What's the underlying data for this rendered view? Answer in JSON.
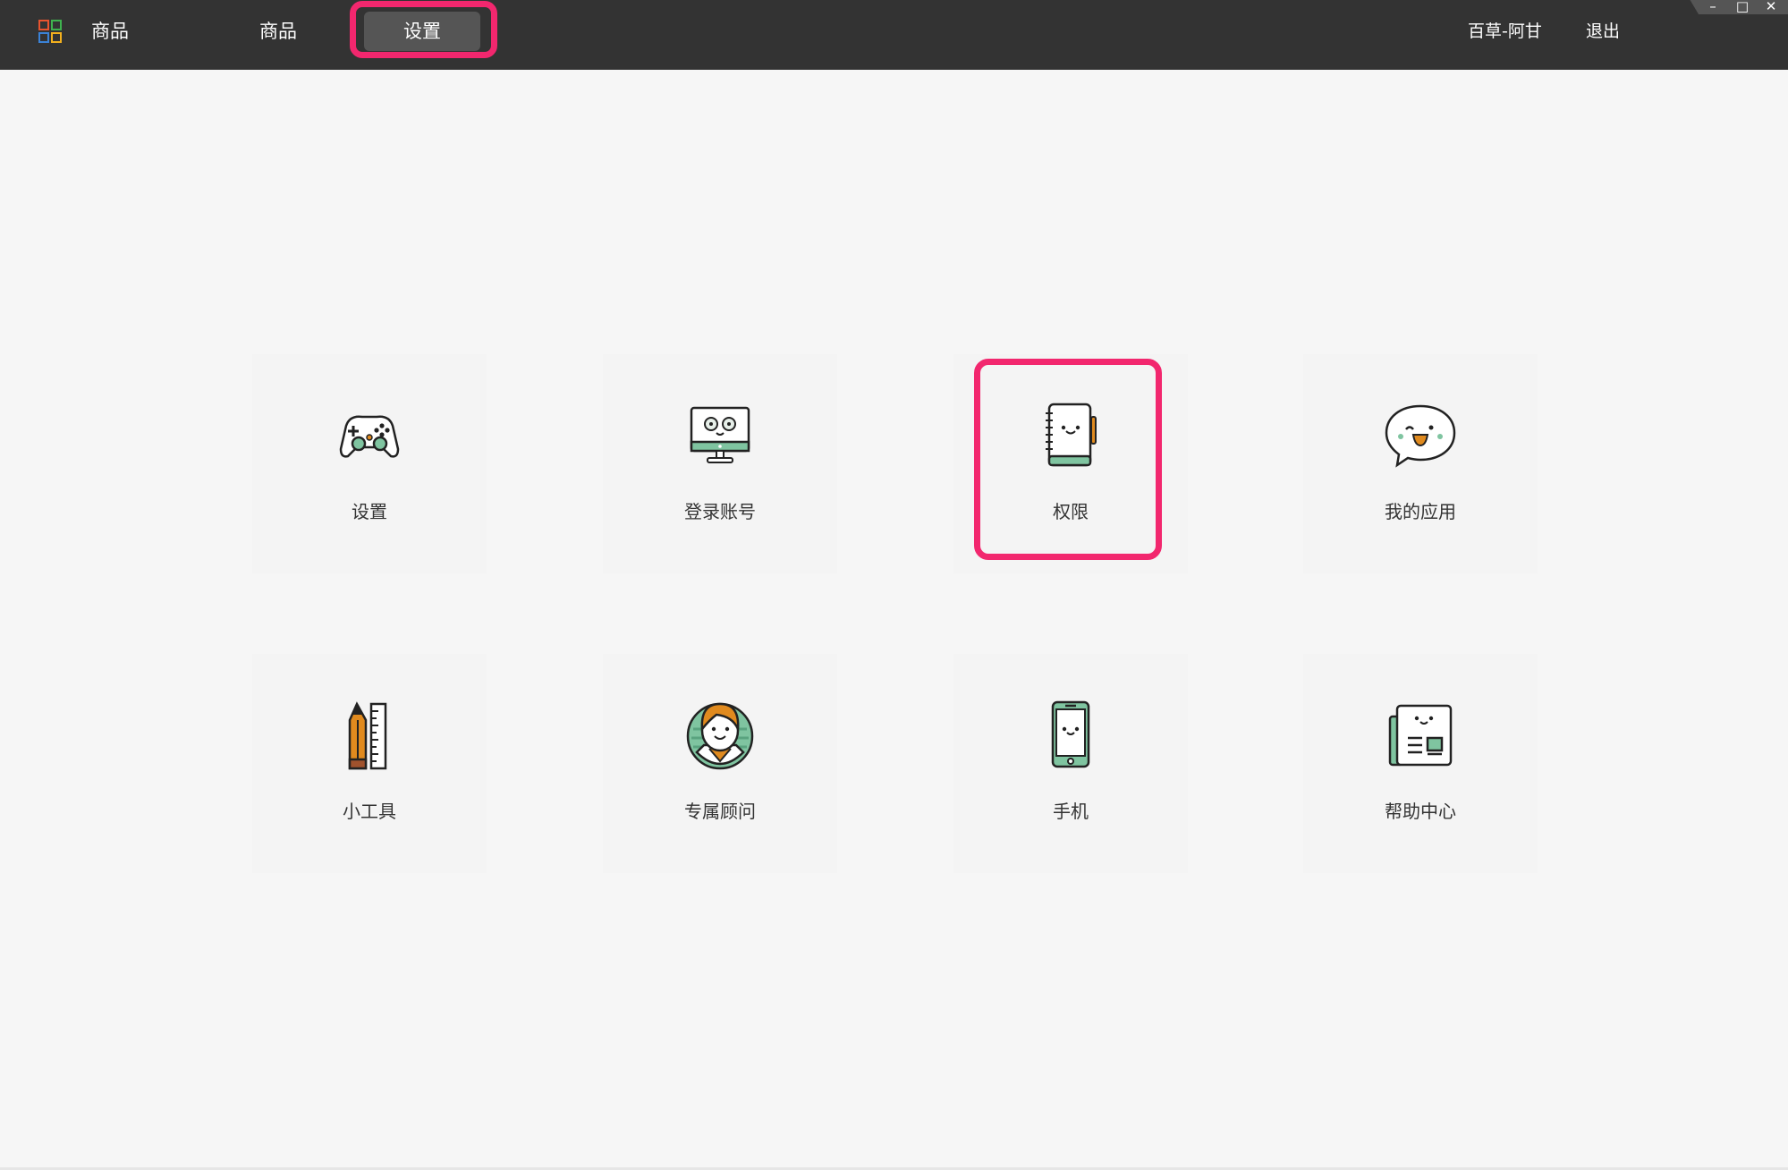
{
  "header": {
    "app_title": "商品",
    "tabs": [
      {
        "label": "商品"
      },
      {
        "label": "设置",
        "active": true
      }
    ],
    "user_name": "百草-阿甘",
    "logout_label": "退出"
  },
  "window_controls": {
    "minimize": "–",
    "maximize": "□",
    "close": "✕"
  },
  "grid": {
    "items": [
      {
        "label": "设置",
        "icon": "gamepad-icon"
      },
      {
        "label": "登录账号",
        "icon": "monitor-icon"
      },
      {
        "label": "权限",
        "icon": "notebook-icon"
      },
      {
        "label": "我的应用",
        "icon": "chat-bubble-icon"
      },
      {
        "label": "小工具",
        "icon": "pencil-ruler-icon"
      },
      {
        "label": "专属顾问",
        "icon": "advisor-avatar-icon"
      },
      {
        "label": "手机",
        "icon": "phone-icon"
      },
      {
        "label": "帮助中心",
        "icon": "help-document-icon"
      }
    ]
  },
  "colors": {
    "topbar": "#333333",
    "background": "#f6f6f6",
    "highlight": "#f2276e",
    "icon_green": "#7fc4a0",
    "icon_orange": "#e08a1e"
  }
}
